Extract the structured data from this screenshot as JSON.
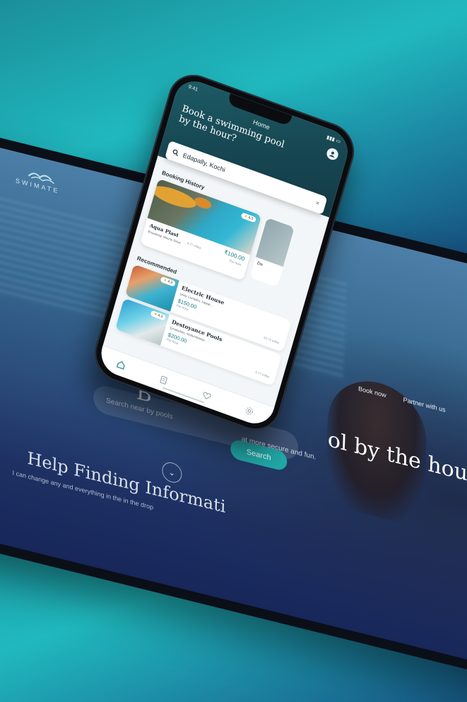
{
  "tablet": {
    "logo_text": "SWIMATE",
    "nav": {
      "book_now": "Book now",
      "partner": "Partner with us"
    },
    "headline_lead": "B",
    "headline_tail": "ol by the hour?",
    "subtext": "at more secure and fun.",
    "search_placeholder": "Search near by pools",
    "search_button": "Search",
    "help_title": "Help Finding Informati",
    "help_sub": "I can change any and everything in the in the drop"
  },
  "phone": {
    "status_time": "9:41",
    "title": "Home",
    "heading": "Book a swimming pool by the hour?",
    "search_value": "Edapally, Kochi",
    "booking_history_label": "Booking History",
    "booking_card": {
      "name": "Aqua Plast",
      "address": "Broadway, Marine Drive",
      "distance": "4.77 miles",
      "price": "₹100.00",
      "per": "Per hour",
      "rating": "4.3"
    },
    "booking_peek_name": "De",
    "recommended_label": "Recommended",
    "recommended": [
      {
        "name": "Electric House",
        "address": "Unity Complex, Irapiat...",
        "price": "$150.00",
        "per": "Per hour",
        "distance": "10.74 miles",
        "rating": "4.3"
      },
      {
        "name": "Destoyance Pools",
        "address": "Ernakulam, Nedumbassy...",
        "price": "$200.00",
        "per": "Per hour",
        "distance": "4.77 miles",
        "rating": "4.3"
      }
    ]
  },
  "colors": {
    "accent": "#22a7a7",
    "header": "#174853",
    "price": "#1a7b86"
  }
}
